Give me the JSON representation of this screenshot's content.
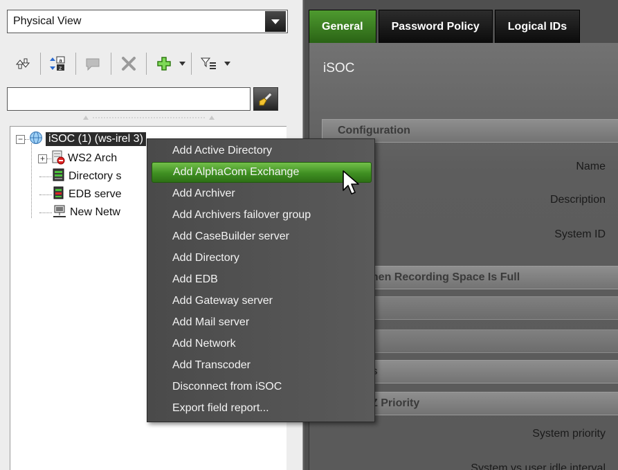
{
  "left": {
    "view_select": {
      "value": "Physical View"
    },
    "search": {
      "value": "",
      "placeholder": ""
    },
    "tree": {
      "root": {
        "label": "iSOC (1) (ws-irel  3)"
      },
      "items": [
        {
          "label": "WS2 Arch"
        },
        {
          "label": "Directory s"
        },
        {
          "label": "EDB serve"
        },
        {
          "label": "New Netw"
        }
      ]
    }
  },
  "right": {
    "tabs": [
      {
        "label": "General"
      },
      {
        "label": "Password Policy"
      },
      {
        "label": "Logical IDs"
      }
    ],
    "entity_title": "iSOC",
    "sections": {
      "configuration": "Configuration",
      "recording": "vior When Recording Space Is Full",
      "entities": "Entities",
      "ptz": "em PTZ Priority"
    },
    "fields": {
      "name": "Name",
      "description": "Description",
      "system_id": "System ID",
      "system_priority": "System priority",
      "idle_interval": "System vs user idle interval"
    }
  },
  "context_menu": {
    "items": [
      {
        "label": "Add Active Directory"
      },
      {
        "label": "Add AlphaCom Exchange"
      },
      {
        "label": "Add Archiver"
      },
      {
        "label": "Add Archivers failover group"
      },
      {
        "label": "Add CaseBuilder server"
      },
      {
        "label": "Add Directory"
      },
      {
        "label": "Add EDB"
      },
      {
        "label": "Add Gateway server"
      },
      {
        "label": "Add Mail server"
      },
      {
        "label": "Add Network"
      },
      {
        "label": "Add Transcoder"
      },
      {
        "label": "Disconnect from iSOC"
      },
      {
        "label": "Export field report..."
      }
    ],
    "highlighted": "Add AlphaCom Exchange"
  },
  "colors": {
    "accent_green": "#3f8f22",
    "dark_bg": "#4f4f4f"
  },
  "icons": {
    "dropdown": "chevron-down-icon",
    "search": "broom-search-icon",
    "root": "globe-icon",
    "archiver": "server-red-icon",
    "directory": "server-green-icon",
    "edb": "server-green-red-icon",
    "network": "network-icon"
  }
}
